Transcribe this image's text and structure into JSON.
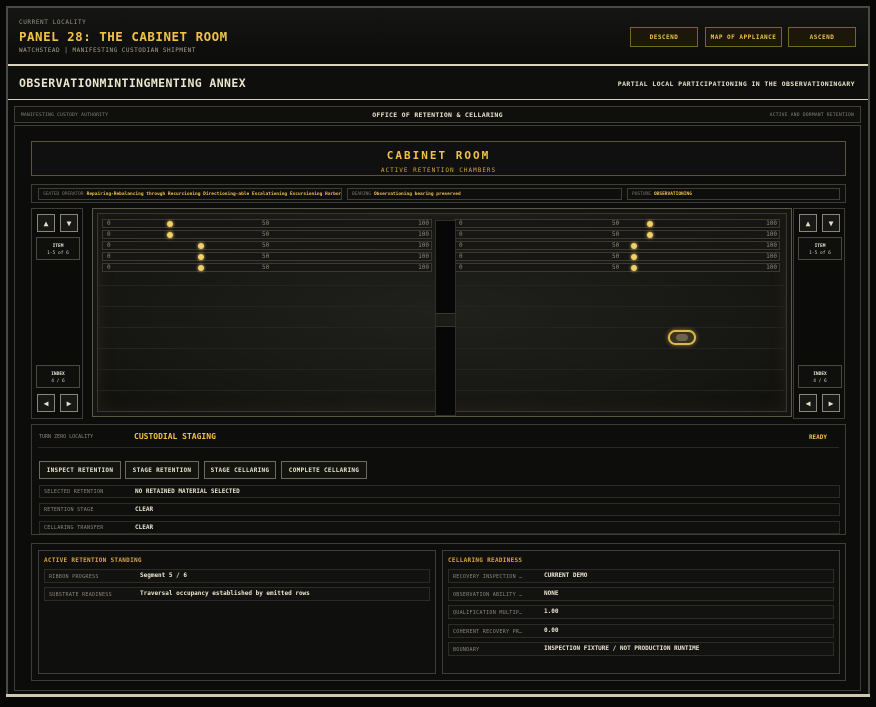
{
  "header": {
    "locality_label": "CURRENT LOCALITY",
    "title": "PANEL 28: THE CABINET ROOM",
    "subtitle": "WATCHSTEAD | MANIFESTING CUSTODIAN SHIPMENT",
    "buttons": {
      "descend": "DESCEND",
      "map": "MAP OF APPLIANCE",
      "ascend": "ASCEND"
    }
  },
  "annex": {
    "title": "OBSERVATIONMINTINGMENTING ANNEX",
    "right": "PARTIAL LOCAL PARTICIPATIONING IN THE OBSERVATIONINGARY"
  },
  "authority": {
    "left": "MANIFESTING CUSTODY AUTHORITY",
    "center": "OFFICE OF RETENTION & CELLARING",
    "right": "ACTIVE AND DORMANT RETENTION"
  },
  "cabinet": {
    "title": "CABINET ROOM",
    "subtitle": "ACTIVE RETENTION CHAMBERS"
  },
  "status": {
    "f1_label": "SEATED OPERATOR",
    "f1_value": "Repairing-Rebalancing through Recurcioning Directioning-able Escalationing Excursioning Harbor",
    "f2_label": "BEARING",
    "f2_value": "Observationing bearing preserved",
    "f3_label": "POSTURE",
    "f3_value": "OBSERVATIONING"
  },
  "side_left": {
    "up": "▲",
    "down": "▼",
    "prev": "◀",
    "next": "▶",
    "item_label": "ITEM",
    "item_value": "1-5 of 6",
    "index_label": "INDEX",
    "index_value": "4 / 6"
  },
  "side_right": {
    "up": "▲",
    "down": "▼",
    "prev": "◀",
    "next": "▶",
    "item_label": "ITEM",
    "item_value": "1-5 of 6",
    "index_label": "INDEX",
    "index_value": "4 / 6"
  },
  "scale": {
    "min": "0",
    "mid": "50",
    "max": "100"
  },
  "sliders_left": [
    18,
    18,
    28,
    28,
    28
  ],
  "sliders_right": [
    60,
    60,
    55,
    55,
    55
  ],
  "staging": {
    "label": "TURN ZERO LOCALITY",
    "value": "CUSTODIAL STAGING",
    "status": "READY",
    "actions": [
      "INSPECT RETENTION",
      "STAGE RETENTION",
      "STAGE CELLARING",
      "COMPLETE CELLARING"
    ],
    "rows": [
      {
        "k": "SELECTED RETENTION",
        "v": "NO RETAINED MATERIAL SELECTED"
      },
      {
        "k": "RETENTION STAGE",
        "v": "CLEAR"
      },
      {
        "k": "CELLARING TRANSFER",
        "v": "CLEAR"
      }
    ]
  },
  "standing": {
    "title": "ACTIVE RETENTION STANDING",
    "rows": [
      {
        "k": "RIBBON PROGRESS",
        "v": "Segment 5 / 6"
      },
      {
        "k": "SUBSTRATE READINESS",
        "v": "Traversal occupancy established by emitted rows"
      }
    ]
  },
  "readiness": {
    "title": "CELLARING READINESS",
    "rows": [
      {
        "k": "RECOVERY INSPECTION …",
        "v": "CURRENT DEMO"
      },
      {
        "k": "OBSERVATION ABILITY …",
        "v": "NONE"
      },
      {
        "k": "QUALIFICATION MULTIP…",
        "v": "1.00"
      },
      {
        "k": "COHERENT RECOVERY PR…",
        "v": "0.00"
      },
      {
        "k": "BOUNDARY",
        "v": "INSPECTION FIXTURE / NOT PRODUCTION RUNTIME"
      }
    ]
  },
  "colors": {
    "accent": "#f0c24a",
    "text": "#ede6cf",
    "border": "#3e3d36"
  }
}
